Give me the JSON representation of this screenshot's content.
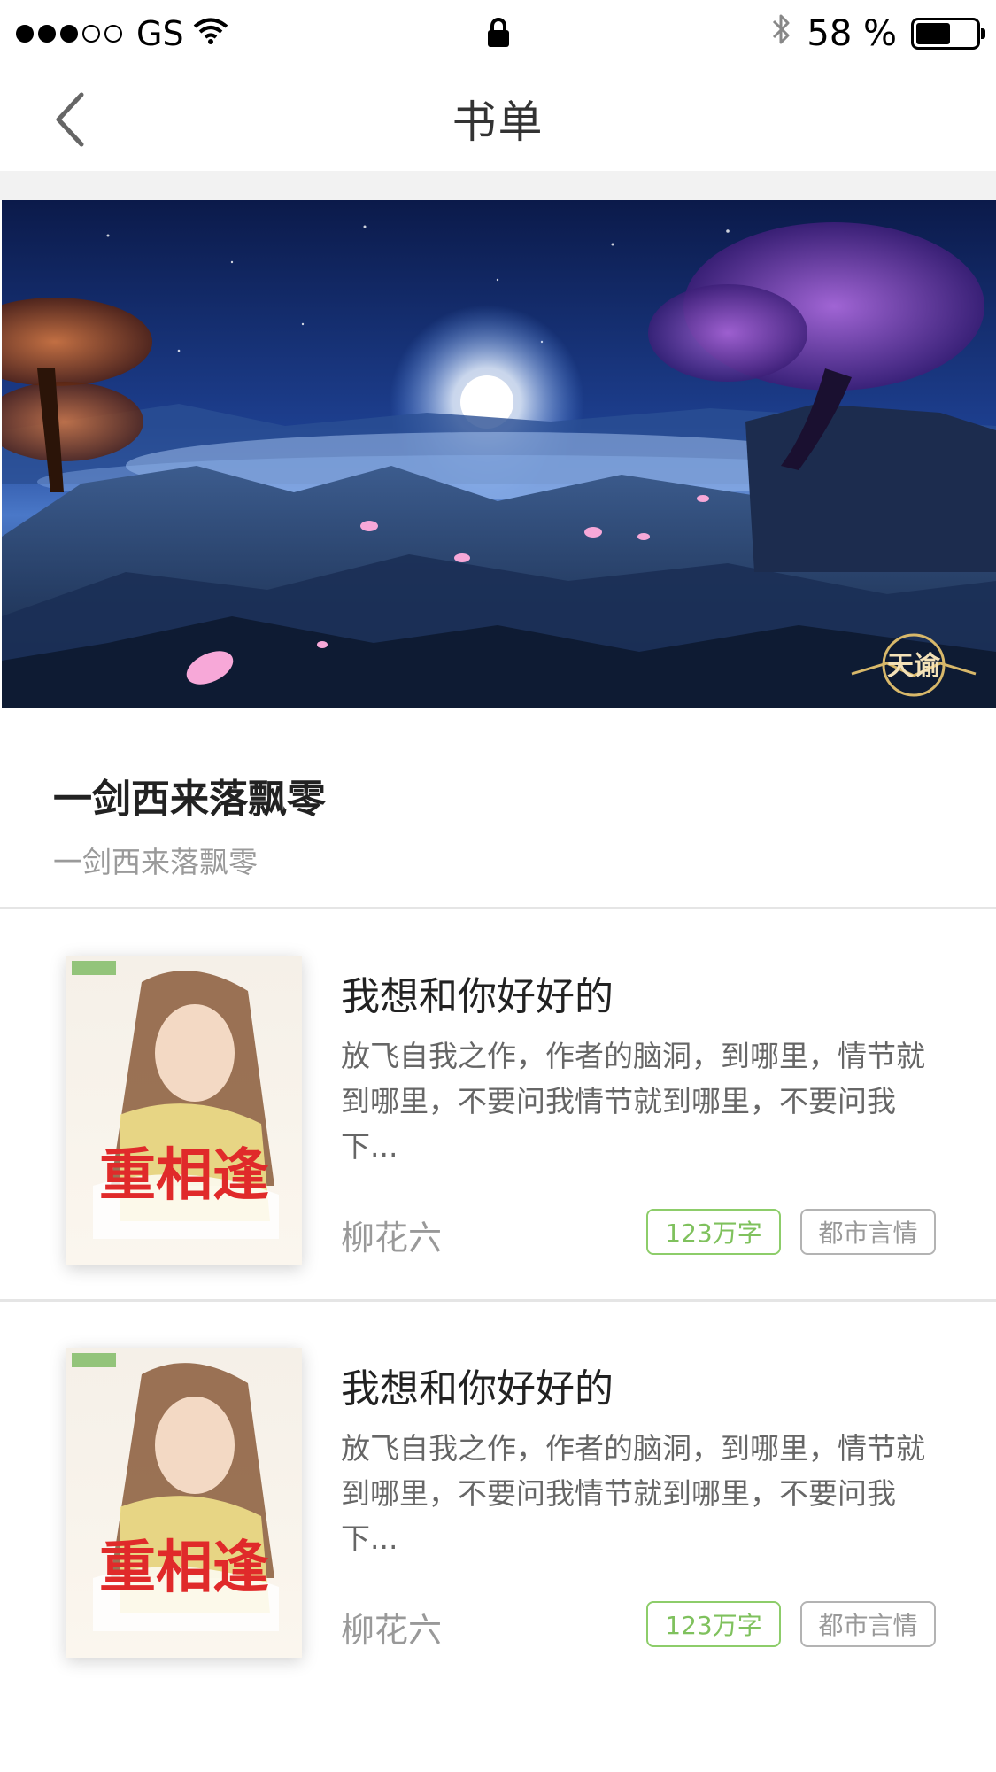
{
  "status_bar": {
    "carrier": "GS",
    "battery_text": "58 %",
    "battery_level": 0.58,
    "signal_dots_filled": 3,
    "signal_dots_total": 5,
    "icons": [
      "signal-dots-icon",
      "wifi-icon",
      "lock-icon",
      "bluetooth-icon",
      "battery-icon"
    ]
  },
  "nav": {
    "title": "书单",
    "back_icon": "chevron-left-icon"
  },
  "banner": {
    "watermark": "天谕"
  },
  "list": {
    "title": "一剑西来落飘零",
    "subtitle": "一剑西来落飘零"
  },
  "books": [
    {
      "title": "我想和你好好的",
      "description": "放飞自我之作，作者的脑洞，到哪里，情节就到哪里，不要问我情节就到哪里，不要问我下...",
      "author": "柳花六",
      "word_count": "123万字",
      "genre": "都市言情",
      "cover_title": "重相逢"
    },
    {
      "title": "我想和你好好的",
      "description": "放飞自我之作，作者的脑洞，到哪里，情节就到哪里，不要问我情节就到哪里，不要问我下...",
      "author": "柳花六",
      "word_count": "123万字",
      "genre": "都市言情",
      "cover_title": "重相逢"
    }
  ],
  "colors": {
    "accent_green": "#7fc15d",
    "tag_gray": "#999999",
    "separator": "#f2f2f2",
    "title_text": "#222222"
  }
}
